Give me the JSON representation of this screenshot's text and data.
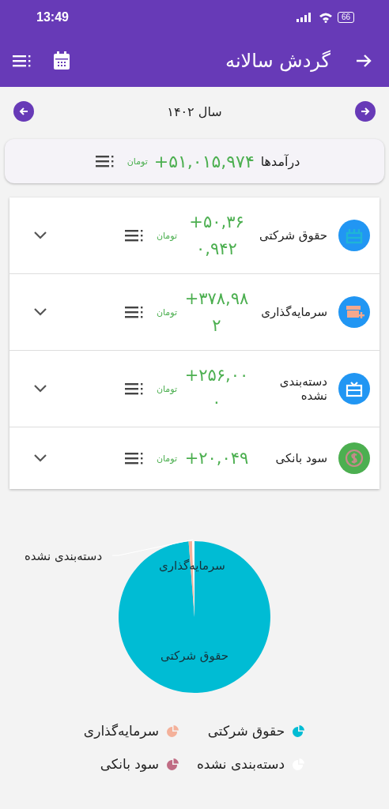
{
  "status_bar": {
    "time": "13:49",
    "battery": "66"
  },
  "app_bar": {
    "title": "گردش سالانه"
  },
  "year_nav": {
    "label": "سال ۱۴۰۲"
  },
  "total": {
    "label": "درآمدها",
    "amount": "+۵۱,۰۱۵,۹۷۴",
    "currency": "تومان"
  },
  "categories": [
    {
      "name": "حقوق شرکتی",
      "amount": "+۵۰,۳۶۰,۹۴۲",
      "currency": "تومان",
      "kind": "cake",
      "color": "#2196f3"
    },
    {
      "name": "سرمایه‌گذاری",
      "amount": "+۳۷۸,۹۸۲",
      "currency": "تومان",
      "kind": "store",
      "color": "#2196f3"
    },
    {
      "name": "دسته‌بندی نشده",
      "amount": "+۲۵۶,۰۰۰",
      "currency": "تومان",
      "kind": "gift",
      "color": "#2196f3"
    },
    {
      "name": "سود بانکی",
      "amount": "+۲۰,۰۴۹",
      "currency": "تومان",
      "kind": "coin",
      "color": "#4caf50"
    }
  ],
  "chart": {
    "chart_data": {
      "type": "pie",
      "categories": [
        "حقوق شرکتی",
        "سرمایه‌گذاری",
        "دسته‌بندی نشده",
        "سود بانکی"
      ],
      "series": [
        {
          "values": [
            98.72,
            0.74,
            0.5,
            null
          ]
        }
      ],
      "colors": [
        "#00bcd4",
        "#f4b19a",
        "#ffffff",
        "#c06c84"
      ],
      "annotations": [
        {
          "text": "حقوق شرکتی"
        },
        {
          "text": "سرمایه‌گذاری"
        },
        {
          "text": "دسته‌بندی نشده"
        }
      ]
    }
  }
}
